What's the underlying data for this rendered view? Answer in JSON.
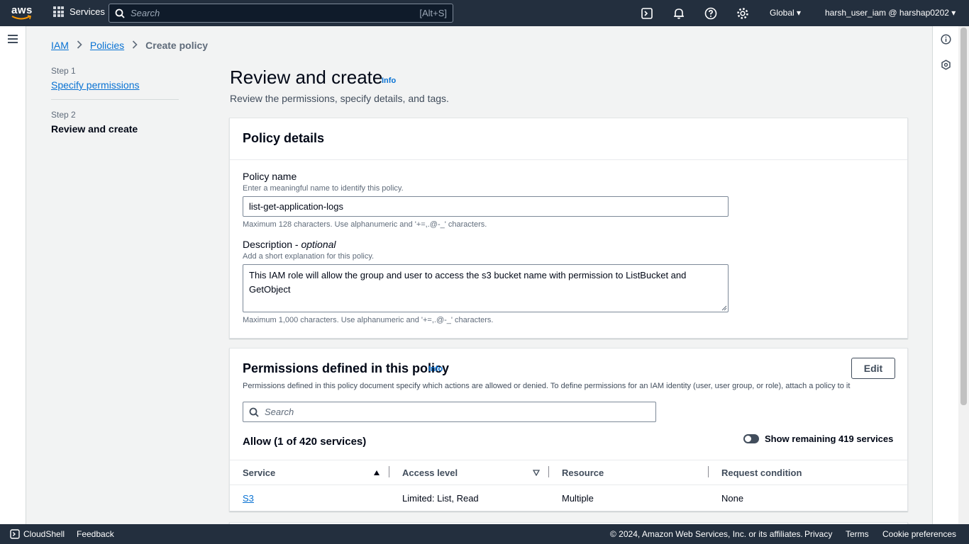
{
  "topnav": {
    "logo_text": "aws",
    "services_label": "Services",
    "search_placeholder": "Search",
    "search_shortcut": "[Alt+S]",
    "region": "Global ▾",
    "user": "harsh_user_iam @ harshap0202 ▾"
  },
  "breadcrumb": {
    "items": [
      "IAM",
      "Policies"
    ],
    "current": "Create policy"
  },
  "steps": [
    {
      "number": "Step 1",
      "label": "Specify permissions"
    },
    {
      "number": "Step 2",
      "label": "Review and create"
    }
  ],
  "page": {
    "title": "Review and create",
    "info": "Info",
    "description": "Review the permissions, specify details, and tags."
  },
  "policy_details": {
    "title": "Policy details",
    "name_label": "Policy name",
    "name_desc": "Enter a meaningful name to identify this policy.",
    "name_value": "list-get-application-logs",
    "name_constraint": "Maximum 128 characters. Use alphanumeric and '+=,.@-_' characters.",
    "desc_label": "Description - ",
    "desc_label_optional": "optional",
    "desc_desc": "Add a short explanation for this policy.",
    "desc_value": "This IAM role will allow the group and user to access the s3 bucket name with permission to ListBucket and GetObject",
    "desc_constraint": "Maximum 1,000 characters. Use alphanumeric and '+=,.@-_' characters."
  },
  "permissions": {
    "title": "Permissions defined in this policy",
    "info": "Info",
    "edit_label": "Edit",
    "description": "Permissions defined in this policy document specify which actions are allowed or denied. To define permissions for an IAM identity (user, user group, or role), attach a policy to it",
    "search_placeholder": "Search",
    "allow_title": "Allow (1 of 420 services)",
    "toggle_label": "Show remaining 419 services",
    "columns": [
      "Service",
      "Access level",
      "Resource",
      "Request condition"
    ],
    "rows": [
      {
        "service": "S3",
        "access": "Limited: List, Read",
        "resource": "Multiple",
        "condition": "None"
      }
    ]
  },
  "footer": {
    "cloudshell": "CloudShell",
    "feedback": "Feedback",
    "copyright": "© 2024, Amazon Web Services, Inc. or its affiliates.",
    "privacy": "Privacy",
    "terms": "Terms",
    "cookies": "Cookie preferences"
  },
  "colors": {
    "nav_bg": "#232f3e",
    "link": "#0972d3",
    "page_bg": "#f2f3f3"
  }
}
